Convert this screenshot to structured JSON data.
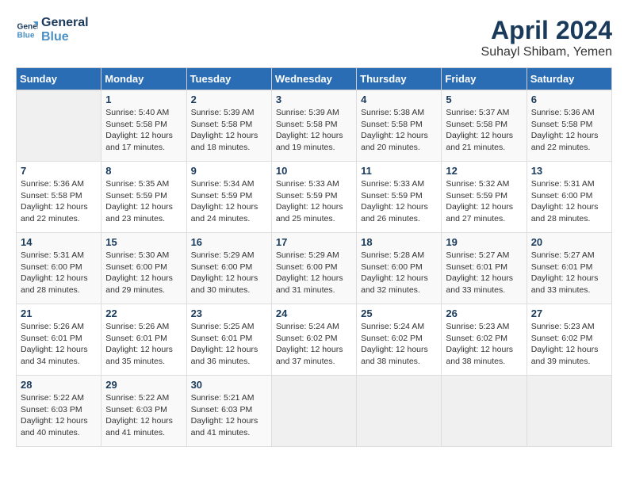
{
  "logo": {
    "line1": "General",
    "line2": "Blue"
  },
  "title": "April 2024",
  "location": "Suhayl Shibam, Yemen",
  "days_header": [
    "Sunday",
    "Monday",
    "Tuesday",
    "Wednesday",
    "Thursday",
    "Friday",
    "Saturday"
  ],
  "weeks": [
    [
      {
        "num": "",
        "info": ""
      },
      {
        "num": "1",
        "info": "Sunrise: 5:40 AM\nSunset: 5:58 PM\nDaylight: 12 hours\nand 17 minutes."
      },
      {
        "num": "2",
        "info": "Sunrise: 5:39 AM\nSunset: 5:58 PM\nDaylight: 12 hours\nand 18 minutes."
      },
      {
        "num": "3",
        "info": "Sunrise: 5:39 AM\nSunset: 5:58 PM\nDaylight: 12 hours\nand 19 minutes."
      },
      {
        "num": "4",
        "info": "Sunrise: 5:38 AM\nSunset: 5:58 PM\nDaylight: 12 hours\nand 20 minutes."
      },
      {
        "num": "5",
        "info": "Sunrise: 5:37 AM\nSunset: 5:58 PM\nDaylight: 12 hours\nand 21 minutes."
      },
      {
        "num": "6",
        "info": "Sunrise: 5:36 AM\nSunset: 5:58 PM\nDaylight: 12 hours\nand 22 minutes."
      }
    ],
    [
      {
        "num": "7",
        "info": "Sunrise: 5:36 AM\nSunset: 5:58 PM\nDaylight: 12 hours\nand 22 minutes."
      },
      {
        "num": "8",
        "info": "Sunrise: 5:35 AM\nSunset: 5:59 PM\nDaylight: 12 hours\nand 23 minutes."
      },
      {
        "num": "9",
        "info": "Sunrise: 5:34 AM\nSunset: 5:59 PM\nDaylight: 12 hours\nand 24 minutes."
      },
      {
        "num": "10",
        "info": "Sunrise: 5:33 AM\nSunset: 5:59 PM\nDaylight: 12 hours\nand 25 minutes."
      },
      {
        "num": "11",
        "info": "Sunrise: 5:33 AM\nSunset: 5:59 PM\nDaylight: 12 hours\nand 26 minutes."
      },
      {
        "num": "12",
        "info": "Sunrise: 5:32 AM\nSunset: 5:59 PM\nDaylight: 12 hours\nand 27 minutes."
      },
      {
        "num": "13",
        "info": "Sunrise: 5:31 AM\nSunset: 6:00 PM\nDaylight: 12 hours\nand 28 minutes."
      }
    ],
    [
      {
        "num": "14",
        "info": "Sunrise: 5:31 AM\nSunset: 6:00 PM\nDaylight: 12 hours\nand 28 minutes."
      },
      {
        "num": "15",
        "info": "Sunrise: 5:30 AM\nSunset: 6:00 PM\nDaylight: 12 hours\nand 29 minutes."
      },
      {
        "num": "16",
        "info": "Sunrise: 5:29 AM\nSunset: 6:00 PM\nDaylight: 12 hours\nand 30 minutes."
      },
      {
        "num": "17",
        "info": "Sunrise: 5:29 AM\nSunset: 6:00 PM\nDaylight: 12 hours\nand 31 minutes."
      },
      {
        "num": "18",
        "info": "Sunrise: 5:28 AM\nSunset: 6:00 PM\nDaylight: 12 hours\nand 32 minutes."
      },
      {
        "num": "19",
        "info": "Sunrise: 5:27 AM\nSunset: 6:01 PM\nDaylight: 12 hours\nand 33 minutes."
      },
      {
        "num": "20",
        "info": "Sunrise: 5:27 AM\nSunset: 6:01 PM\nDaylight: 12 hours\nand 33 minutes."
      }
    ],
    [
      {
        "num": "21",
        "info": "Sunrise: 5:26 AM\nSunset: 6:01 PM\nDaylight: 12 hours\nand 34 minutes."
      },
      {
        "num": "22",
        "info": "Sunrise: 5:26 AM\nSunset: 6:01 PM\nDaylight: 12 hours\nand 35 minutes."
      },
      {
        "num": "23",
        "info": "Sunrise: 5:25 AM\nSunset: 6:01 PM\nDaylight: 12 hours\nand 36 minutes."
      },
      {
        "num": "24",
        "info": "Sunrise: 5:24 AM\nSunset: 6:02 PM\nDaylight: 12 hours\nand 37 minutes."
      },
      {
        "num": "25",
        "info": "Sunrise: 5:24 AM\nSunset: 6:02 PM\nDaylight: 12 hours\nand 38 minutes."
      },
      {
        "num": "26",
        "info": "Sunrise: 5:23 AM\nSunset: 6:02 PM\nDaylight: 12 hours\nand 38 minutes."
      },
      {
        "num": "27",
        "info": "Sunrise: 5:23 AM\nSunset: 6:02 PM\nDaylight: 12 hours\nand 39 minutes."
      }
    ],
    [
      {
        "num": "28",
        "info": "Sunrise: 5:22 AM\nSunset: 6:03 PM\nDaylight: 12 hours\nand 40 minutes."
      },
      {
        "num": "29",
        "info": "Sunrise: 5:22 AM\nSunset: 6:03 PM\nDaylight: 12 hours\nand 41 minutes."
      },
      {
        "num": "30",
        "info": "Sunrise: 5:21 AM\nSunset: 6:03 PM\nDaylight: 12 hours\nand 41 minutes."
      },
      {
        "num": "",
        "info": ""
      },
      {
        "num": "",
        "info": ""
      },
      {
        "num": "",
        "info": ""
      },
      {
        "num": "",
        "info": ""
      }
    ]
  ]
}
